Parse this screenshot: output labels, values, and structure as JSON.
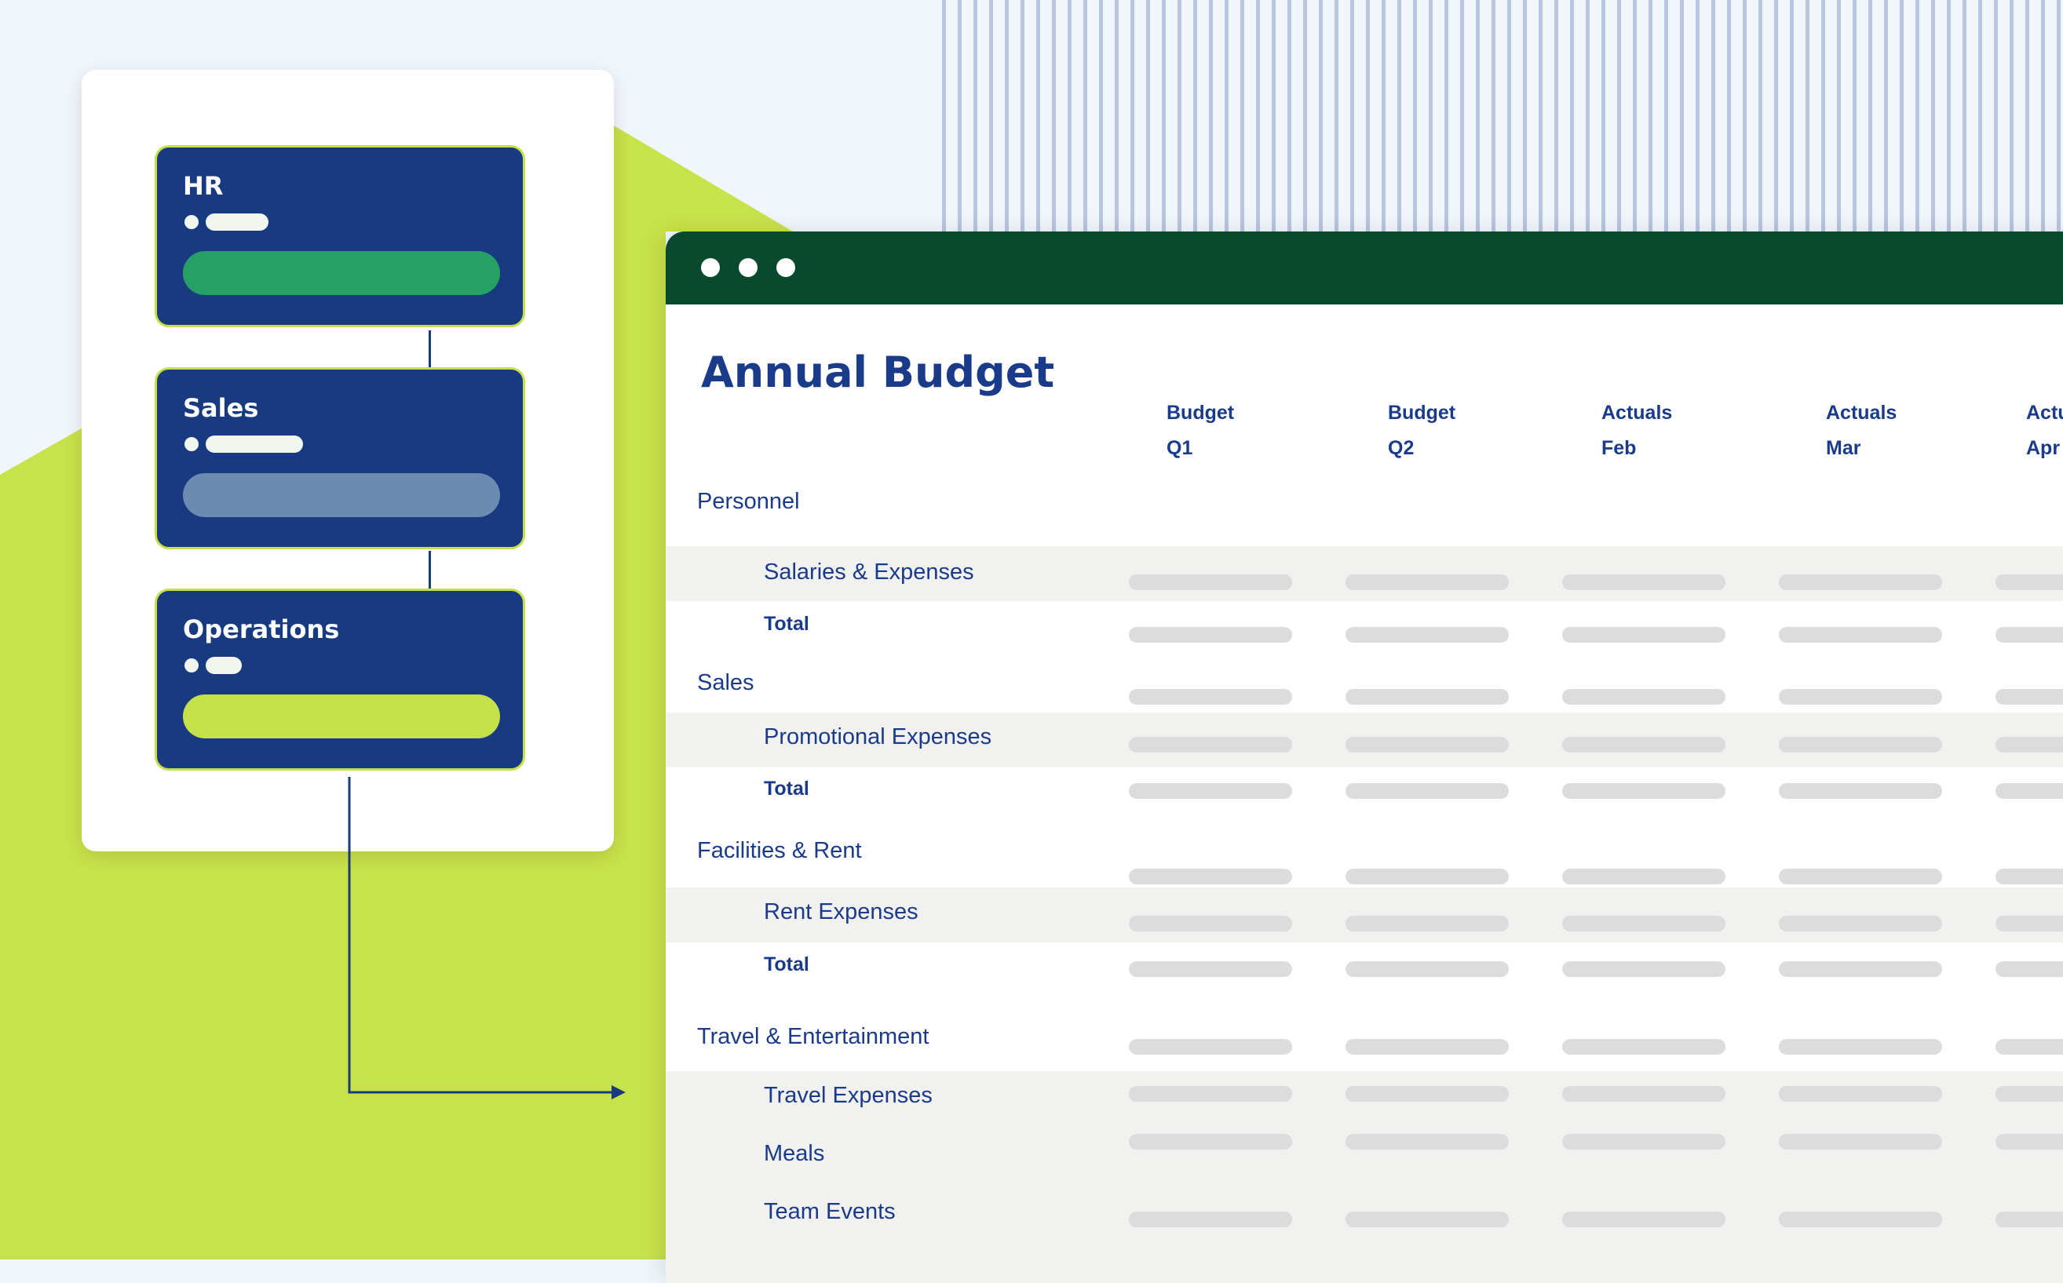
{
  "org_chart": {
    "departments": [
      {
        "name": "HR",
        "bar_color": "#26a064",
        "pill_fraction": 0.28
      },
      {
        "name": "Sales",
        "bar_color": "#6d8bb0",
        "pill_fraction": 0.43
      },
      {
        "name": "Operations",
        "bar_color": "#c6e04a",
        "pill_fraction": 0.16
      }
    ]
  },
  "window": {
    "title": "Annual Budget",
    "columns": [
      {
        "line1": "Budget",
        "line2": "Q1"
      },
      {
        "line1": "Budget",
        "line2": "Q2"
      },
      {
        "line1": "Actuals",
        "line2": "Feb"
      },
      {
        "line1": "Actuals",
        "line2": "Mar"
      },
      {
        "line1": "Actuals",
        "line2": "Apr"
      }
    ],
    "rows": [
      {
        "label": "Personnel",
        "kind": "section"
      },
      {
        "label": "Salaries & Expenses",
        "kind": "sub"
      },
      {
        "label": "Total",
        "kind": "total"
      },
      {
        "label": "Sales",
        "kind": "section"
      },
      {
        "label": "Promotional Expenses",
        "kind": "sub"
      },
      {
        "label": "Total",
        "kind": "total"
      },
      {
        "label": "Facilities & Rent",
        "kind": "section"
      },
      {
        "label": "Rent Expenses",
        "kind": "sub"
      },
      {
        "label": "Total",
        "kind": "total"
      },
      {
        "label": "Travel & Entertainment",
        "kind": "section"
      },
      {
        "label": "Travel Expenses",
        "kind": "sub"
      },
      {
        "label": "Meals",
        "kind": "sub"
      },
      {
        "label": "Team Events",
        "kind": "sub"
      }
    ]
  },
  "colors": {
    "navy": "#183a80",
    "lime": "#c6e04a",
    "titlebar_green": "#094a2f",
    "text_blue": "#1a3a8a",
    "placeholder_gray": "#dcdcdc"
  }
}
